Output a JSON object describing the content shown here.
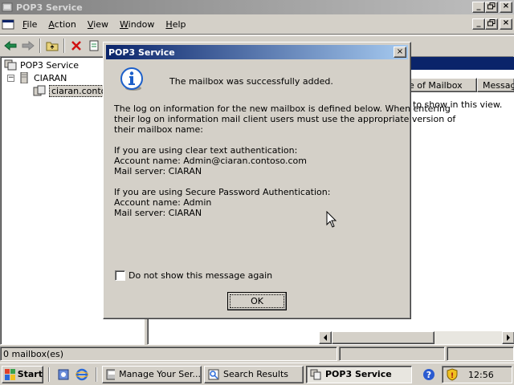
{
  "window": {
    "title": "POP3 Service",
    "controls": {
      "minimize": "_",
      "maximize": "▫",
      "close": "×"
    }
  },
  "menu": [
    {
      "label": "File",
      "key": "F",
      "rest": "ile"
    },
    {
      "label": "Action",
      "key": "A",
      "rest": "ction"
    },
    {
      "label": "View",
      "key": "V",
      "rest": "iew"
    },
    {
      "label": "Window",
      "key": "W",
      "rest": "indow"
    },
    {
      "label": "Help",
      "key": "H",
      "rest": "elp"
    }
  ],
  "toolbar": {
    "icons": [
      "back-arrow-icon",
      "forward-arrow-icon",
      "up-folder-icon",
      "delete-icon",
      "properties-icon"
    ]
  },
  "tree": {
    "root": "POP3 Service",
    "server": "CIARAN",
    "domain": "ciaran.contos"
  },
  "list": {
    "columns": [
      "e of Mailbox",
      "Message"
    ],
    "empty_message": "to show in this view."
  },
  "status": {
    "text": "0 mailbox(es)"
  },
  "dialog": {
    "title": "POP3 Service",
    "close": "×",
    "headline": "The mailbox was successfully added.",
    "intro": [
      "The log on information for the new mailbox is defined below.  When entering",
      "their log on information mail client users must use the appropriate version of",
      "their mailbox name:"
    ],
    "clear": {
      "heading": "If you are using clear text authentication:",
      "account": "Account name: Admin@ciaran.contoso.com",
      "server": "Mail server: CIARAN"
    },
    "spa": {
      "heading": "If you are using Secure Password Authentication:",
      "account": "Account name: Admin",
      "server": "Mail server: CIARAN"
    },
    "checkbox_label": "Do not show this message again",
    "checkbox_checked": false,
    "ok_label": "OK"
  },
  "taskbar": {
    "start_label": "Start",
    "tasks": [
      {
        "label": "Manage Your Ser...",
        "active": false
      },
      {
        "label": "Search Results",
        "active": false
      },
      {
        "label": "POP3 Service",
        "active": true
      }
    ],
    "clock": "12:56"
  },
  "colors": {
    "active_title": "#0a246a",
    "inactive_title": "#808080",
    "face": "#d4d0c8",
    "info_icon": "#1c5fc9"
  }
}
